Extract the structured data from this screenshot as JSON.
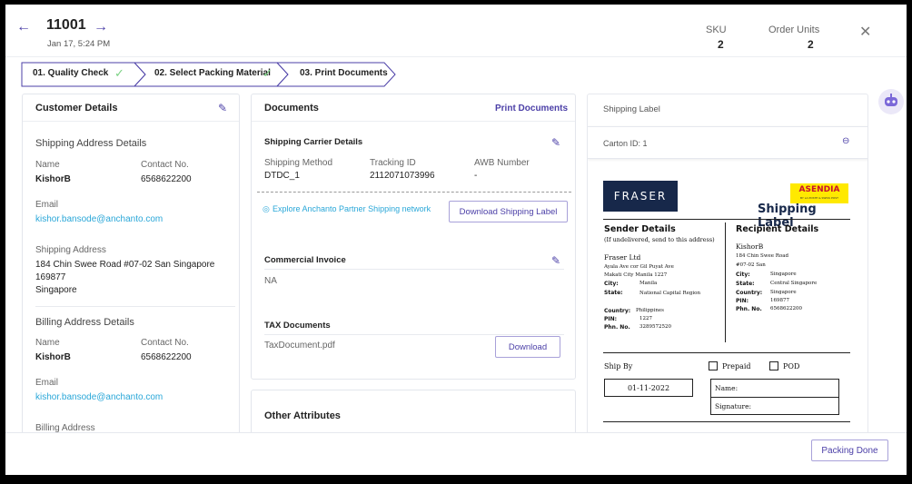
{
  "header": {
    "order_id": "11001",
    "date": "Jan 17, 5:24 PM",
    "sku_label": "SKU",
    "sku_value": "2",
    "units_label": "Order Units",
    "units_value": "2"
  },
  "stepper": {
    "steps": [
      "01. Quality Check",
      "02. Select Packing Material",
      "03. Print Documents"
    ]
  },
  "customer": {
    "title": "Customer Details",
    "shipping_section": "Shipping Address Details",
    "name_label": "Name",
    "contact_label": "Contact No.",
    "name": "KishorB",
    "contact": "6568622200",
    "email_label": "Email",
    "email": "kishor.bansode@anchanto.com",
    "address_label": "Shipping Address",
    "address_line1": "184 Chin Swee Road #07-02 San Singapore",
    "address_line2": "169877",
    "address_line3": "Singapore",
    "billing_section": "Billing Address Details",
    "billing_name_label": "Name",
    "billing_contact_label": "Contact No.",
    "billing_name": "KishorB",
    "billing_contact": "6568622200",
    "billing_email_label": "Email",
    "billing_email": "kishor.bansode@anchanto.com",
    "billing_address_label": "Billing Address"
  },
  "documents": {
    "title": "Documents",
    "print_link": "Print Documents",
    "carrier_title": "Shipping Carrier Details",
    "method_label": "Shipping Method",
    "tracking_label": "Tracking ID",
    "awb_label": "AWB Number",
    "method": "DTDC_1",
    "tracking": "2112071073996",
    "awb": "-",
    "explore_link": "Explore Anchanto Partner Shipping network",
    "download_label_btn": "Download Shipping Label",
    "invoice_title": "Commercial Invoice",
    "invoice_value": "NA",
    "tax_title": "TAX Documents",
    "tax_file": "TaxDocument.pdf",
    "download_btn": "Download",
    "other_title": "Other Attributes"
  },
  "shipping_label_panel": {
    "title": "Shipping Label",
    "carton": "Carton ID: 1"
  },
  "label": {
    "carrier_logo": "FRASER",
    "asendia_logo": "ASENDIA",
    "asendia_sub": "BY LA POSTE & SWISS POST",
    "heading": "Shipping Label",
    "sender_title": "Sender Details",
    "sender_note": "(If undelivered, send to this address)",
    "sender_name": "Fraser Ltd",
    "sender_addr1": "Ayala Ave cor Gil Puyat Ave",
    "sender_addr2": "Makati City Manila 1227",
    "city_label": "City:",
    "sender_city": "Manila",
    "state_label": "State:",
    "sender_state": "National Capital Region",
    "country_label": "Country:",
    "sender_country": "Philippines",
    "pin_label": "PIN:",
    "sender_pin": "1227",
    "phone_label": "Phn. No.",
    "sender_phone": "3289572520",
    "recipient_title": "Recipient Details",
    "recipient_name": "KishorB",
    "recipient_addr1": "184 Chin Swee Road",
    "recipient_addr2": "#07-02 San",
    "recipient_city": "Singapore",
    "recipient_state": "Central Singapore",
    "recipient_country": "Singapore",
    "recipient_pin": "169877",
    "recipient_phone": "6568622200",
    "ship_by_label": "Ship By",
    "prepaid_label": "Prepaid",
    "pod_label": "POD",
    "ship_date": "01-11-2022",
    "name_field": "Name:",
    "signature_field": "Signature:"
  },
  "footer": {
    "packing_done": "Packing Done"
  },
  "colors": {
    "accent": "#4b3fa7",
    "link": "#2aa7d8",
    "check": "#7bd283",
    "fraser_bg": "#17284a",
    "asendia_bg": "#ffe900"
  }
}
